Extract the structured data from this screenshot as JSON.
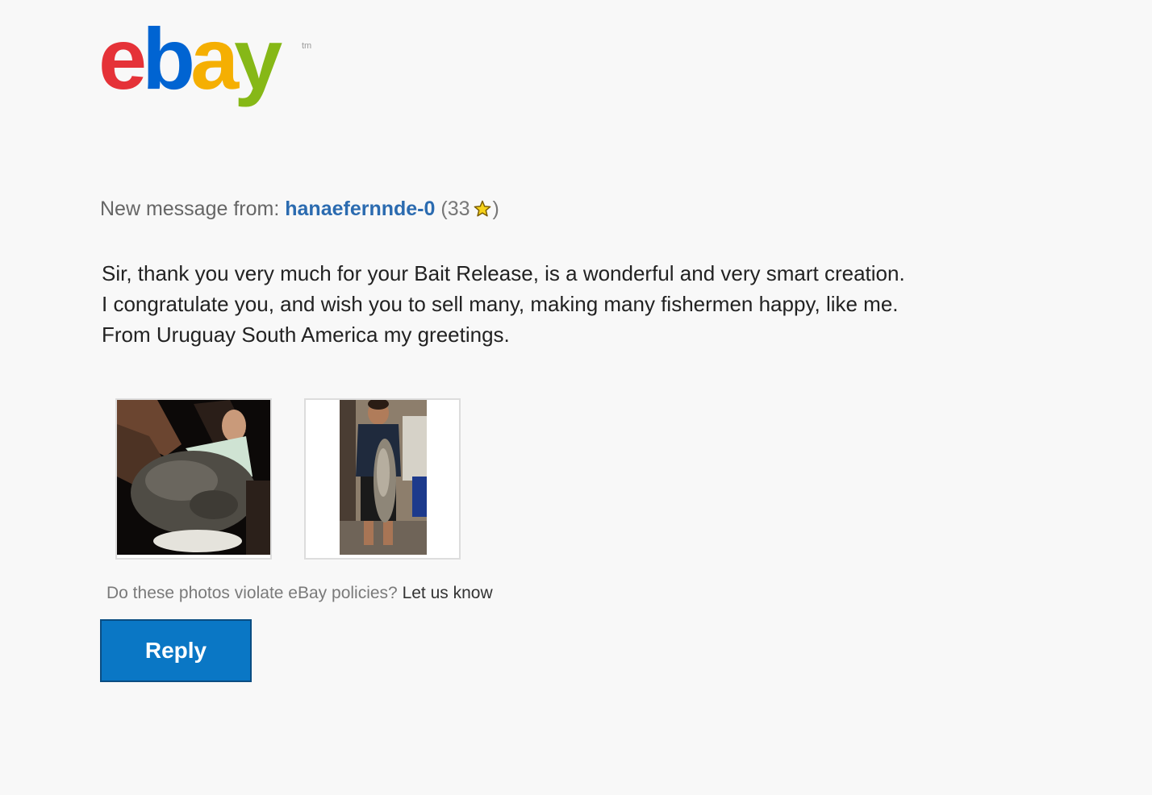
{
  "logo": {
    "letters": [
      "e",
      "b",
      "a",
      "y"
    ],
    "trademark": "tm",
    "colors": {
      "e": "#e53238",
      "b": "#0064d2",
      "a": "#f5af02",
      "y": "#86b817",
      "trademark": "#9a9a9a"
    }
  },
  "header": {
    "prefix": "New message from:",
    "sender": "hanaefernnde-0",
    "feedback_open": "(33",
    "feedback_icon": "yellow-star-icon",
    "feedback_close": ")"
  },
  "message": {
    "lines": [
      "Sir, thank you very much for your Bait Release, is a wonderful and very smart creation.",
      "I congratulate you, and wish you to sell many, making many fishermen happy, like me.",
      "From Uruguay South America my greetings."
    ]
  },
  "policy": {
    "question": "Do these photos violate eBay policies?",
    "link": "Let us know"
  },
  "actions": {
    "reply_label": "Reply"
  },
  "colors": {
    "sender_link": "#2b6bb0",
    "reply_button": "#0a77c5",
    "background": "#f8f8f8"
  }
}
